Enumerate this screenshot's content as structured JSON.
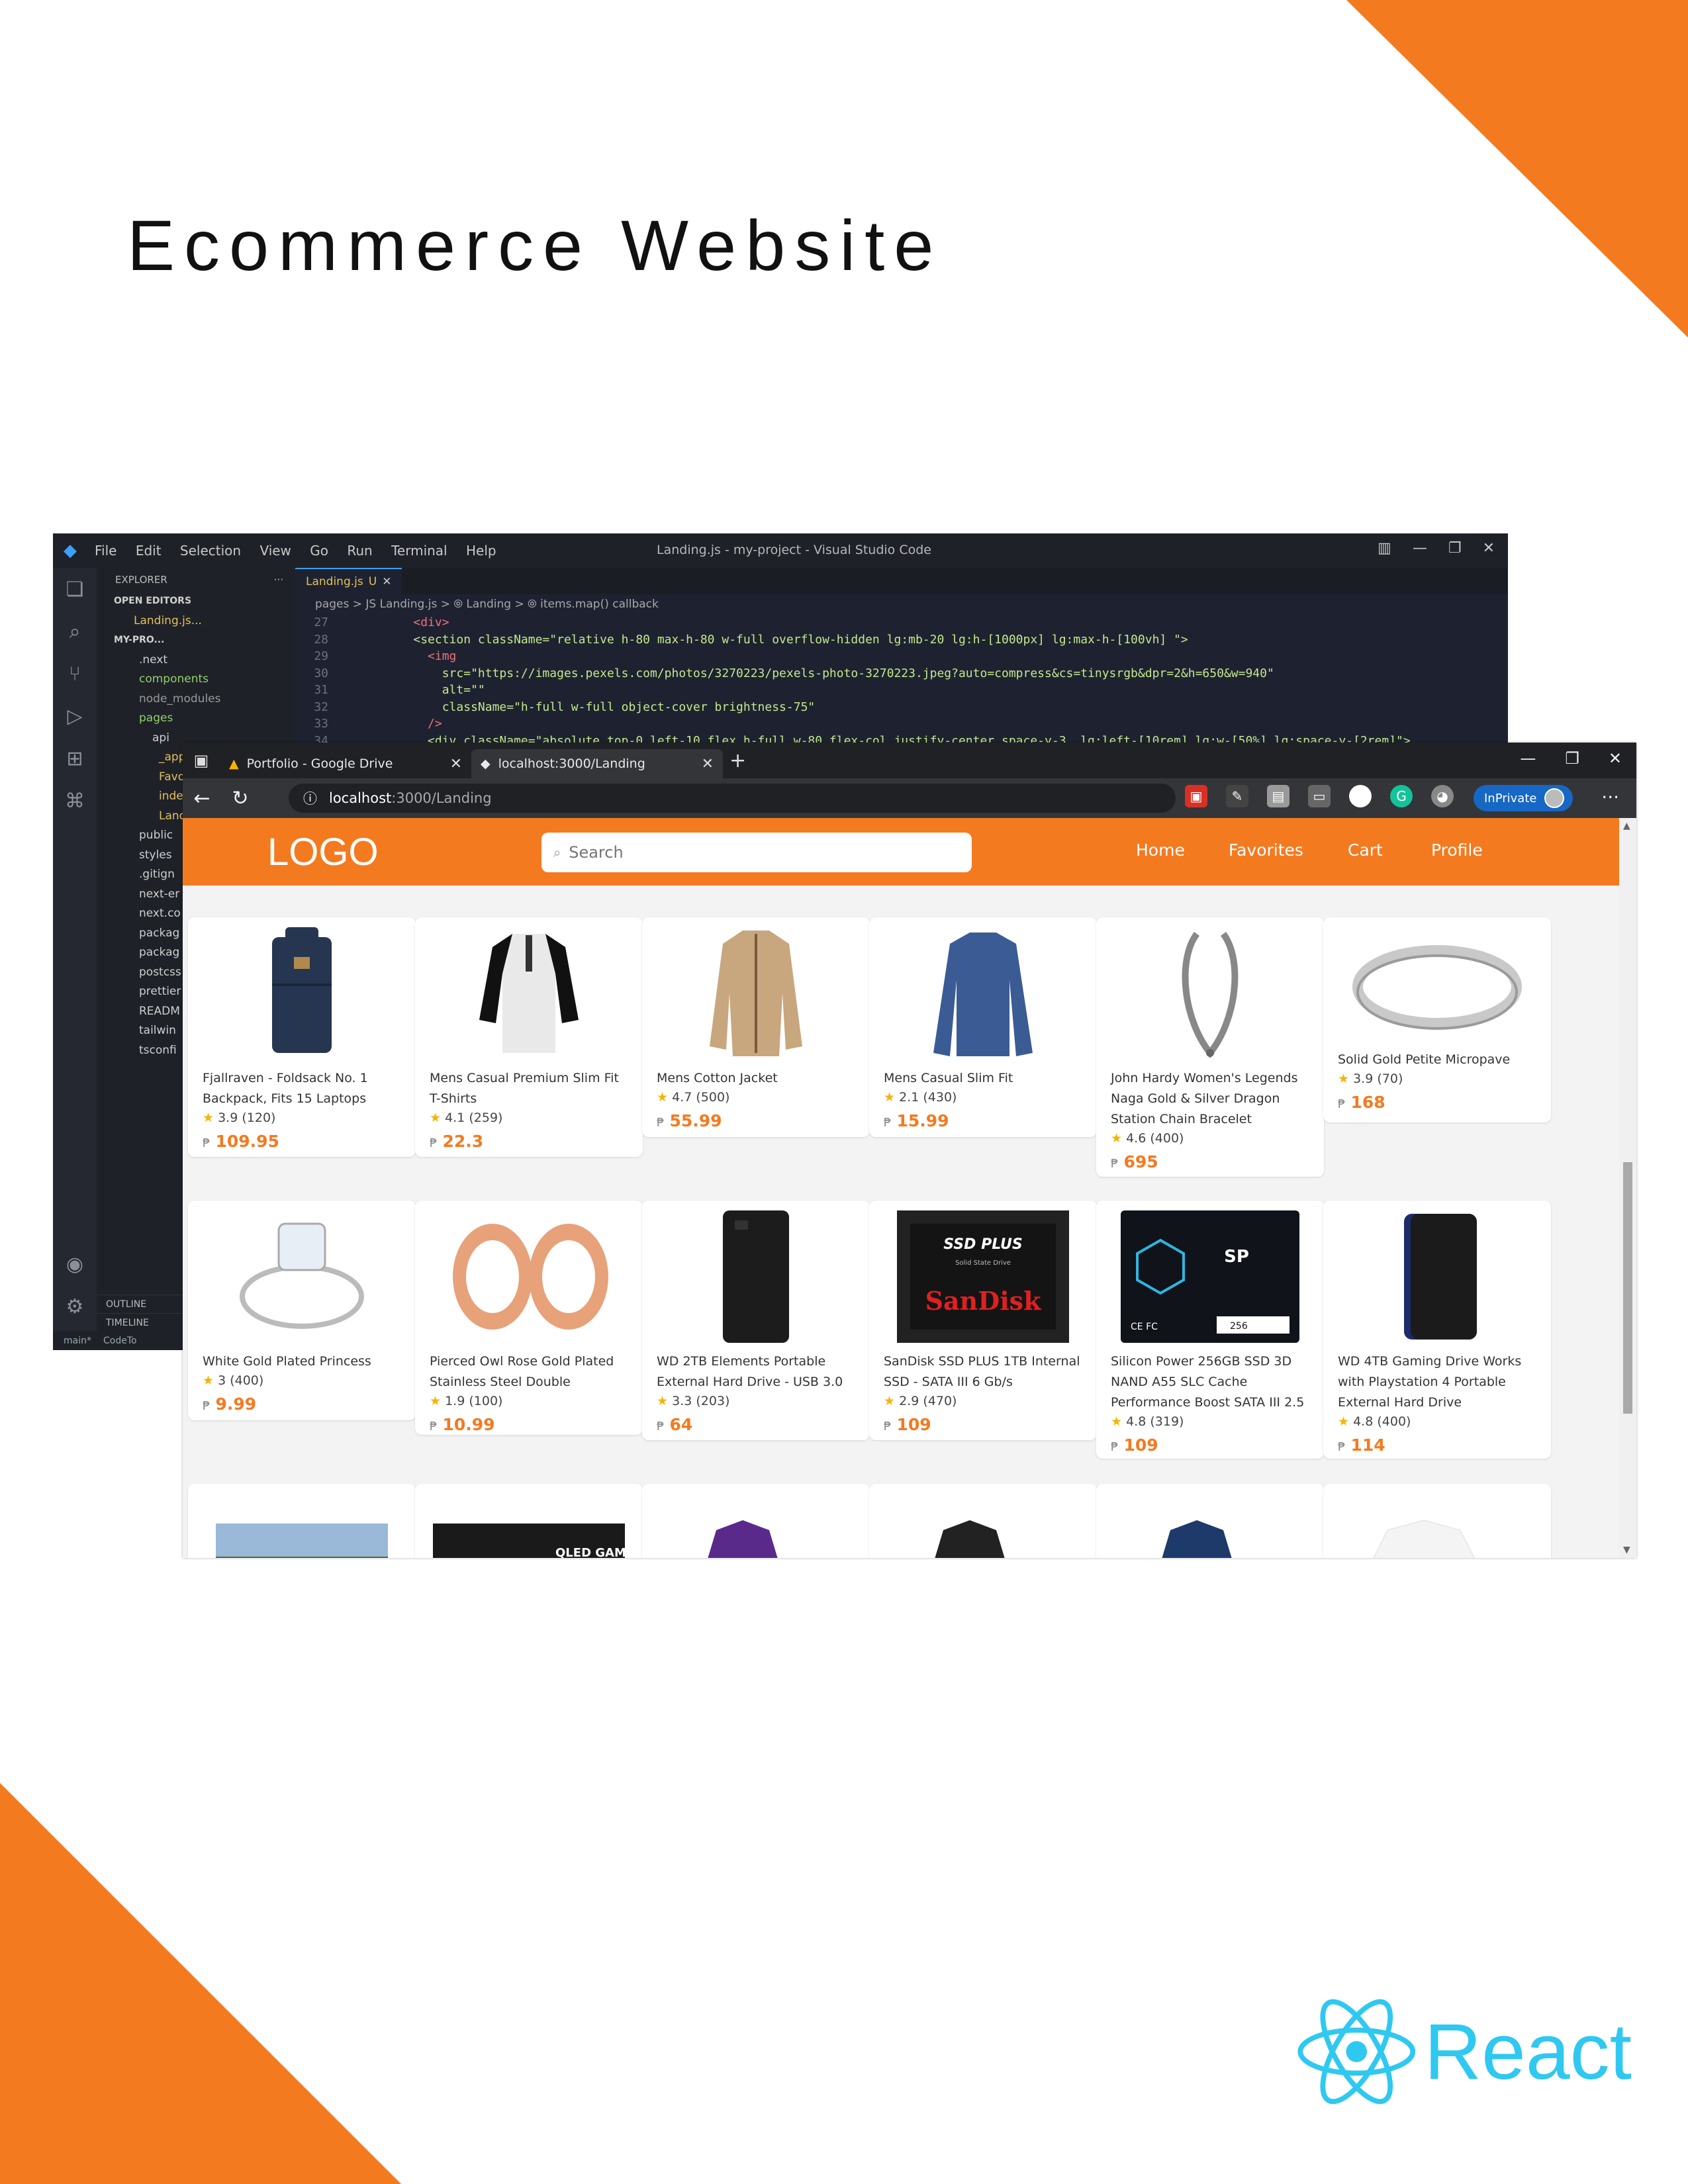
{
  "slide": {
    "title": "Ecommerce Website",
    "brand": "React"
  },
  "vscode": {
    "menu": [
      "File",
      "Edit",
      "Selection",
      "View",
      "Go",
      "Run",
      "Terminal",
      "Help"
    ],
    "window_title": "Landing.js - my-project - Visual Studio Code",
    "explorer_label": "EXPLORER",
    "open_editors_label": "OPEN EDITORS",
    "open_editor_file": "Landing.js...",
    "project_label": "MY-PRO...",
    "tree": [
      ".next",
      "components",
      "node_modules",
      "pages",
      "api",
      "_app.t",
      "Favori",
      "index.",
      "Landi",
      "public",
      "styles",
      ".gitign",
      "next-er",
      "next.co",
      "packag",
      "packag",
      "postcss",
      "prettier",
      "READM",
      "tailwin",
      "tsconfi"
    ],
    "tab_label": "Landing.js",
    "tab_badge": "U",
    "breadcrumb": "pages > JS Landing.js > ⦾ Landing > ⦾ items.map() callback",
    "code_lines": [
      {
        "num": "27",
        "text": "          <div>"
      },
      {
        "num": "28",
        "text": "          <section className=\"relative h-80 max-h-80 w-full overflow-hidden lg:mb-20 lg:h-[1000px] lg:max-h-[100vh] \">"
      },
      {
        "num": "29",
        "text": "            <img"
      },
      {
        "num": "30",
        "text": "              src=\"https://images.pexels.com/photos/3270223/pexels-photo-3270223.jpeg?auto=compress&cs=tinysrgb&dpr=2&h=650&w=940\""
      },
      {
        "num": "31",
        "text": "              alt=\"\""
      },
      {
        "num": "32",
        "text": "              className=\"h-full w-full object-cover brightness-75\""
      },
      {
        "num": "33",
        "text": "            />"
      },
      {
        "num": "34",
        "text": "            <div className=\"absolute top-0 left-10 flex h-full w-80 flex-col justify-center space-y-3  lg:left-[10rem] lg:w-[50%] lg:space-y-[2rem]\">"
      }
    ],
    "outline_label": "OUTLINE",
    "timeline_label": "TIMELINE",
    "status_branch": "main*",
    "status_extra": "CodeTo"
  },
  "browser": {
    "tabs": [
      {
        "label": "Portfolio - Google Drive"
      },
      {
        "label": "localhost:3000/Landing"
      }
    ],
    "url_host": "localhost",
    "url_path": ":3000/Landing",
    "inprivate_label": "InPrivate"
  },
  "site": {
    "logo": "LOGO",
    "search_placeholder": "Search",
    "nav": [
      "Home",
      "Favorites",
      "Cart",
      "Profile"
    ],
    "currency": "₱",
    "products": [
      {
        "title": "Fjallraven - Foldsack No. 1 Backpack, Fits 15 Laptops",
        "rating": "3.9 (120)",
        "price": "109.95"
      },
      {
        "title": "Mens Casual Premium Slim Fit T-Shirts",
        "rating": "4.1 (259)",
        "price": "22.3"
      },
      {
        "title": "Mens Cotton Jacket",
        "rating": "4.7 (500)",
        "price": "55.99"
      },
      {
        "title": "Mens Casual Slim Fit",
        "rating": "2.1 (430)",
        "price": "15.99"
      },
      {
        "title": "John Hardy Women's Legends Naga Gold & Silver Dragon Station Chain Bracelet",
        "rating": "4.6 (400)",
        "price": "695"
      },
      {
        "title": "Solid Gold Petite Micropave",
        "rating": "3.9 (70)",
        "price": "168"
      },
      {
        "title": "White Gold Plated Princess",
        "rating": "3 (400)",
        "price": "9.99"
      },
      {
        "title": "Pierced Owl Rose Gold Plated Stainless Steel Double",
        "rating": "1.9 (100)",
        "price": "10.99"
      },
      {
        "title": "WD 2TB Elements Portable External Hard Drive - USB 3.0",
        "rating": "3.3 (203)",
        "price": "64"
      },
      {
        "title": "SanDisk SSD PLUS 1TB Internal SSD - SATA III 6 Gb/s",
        "rating": "2.9 (470)",
        "price": "109"
      },
      {
        "title": "Silicon Power 256GB SSD 3D NAND A55 SLC Cache Performance Boost SATA III 2.5",
        "rating": "4.8 (319)",
        "price": "109"
      },
      {
        "title": "WD 4TB Gaming Drive Works with Playstation 4 Portable External Hard Drive",
        "rating": "4.8 (400)",
        "price": "114"
      }
    ],
    "image_labels": {
      "ssd_plus": "SSD PLUS",
      "ssd_sub": "Solid State Drive",
      "sandisk": "SanDisk",
      "sp": "SP",
      "sp_cap": "256",
      "qled": "QLED GAMING MONITOR"
    }
  },
  "colors": {
    "accent": "#f47a20",
    "react": "#2fc8f0",
    "star": "#f5b400"
  }
}
